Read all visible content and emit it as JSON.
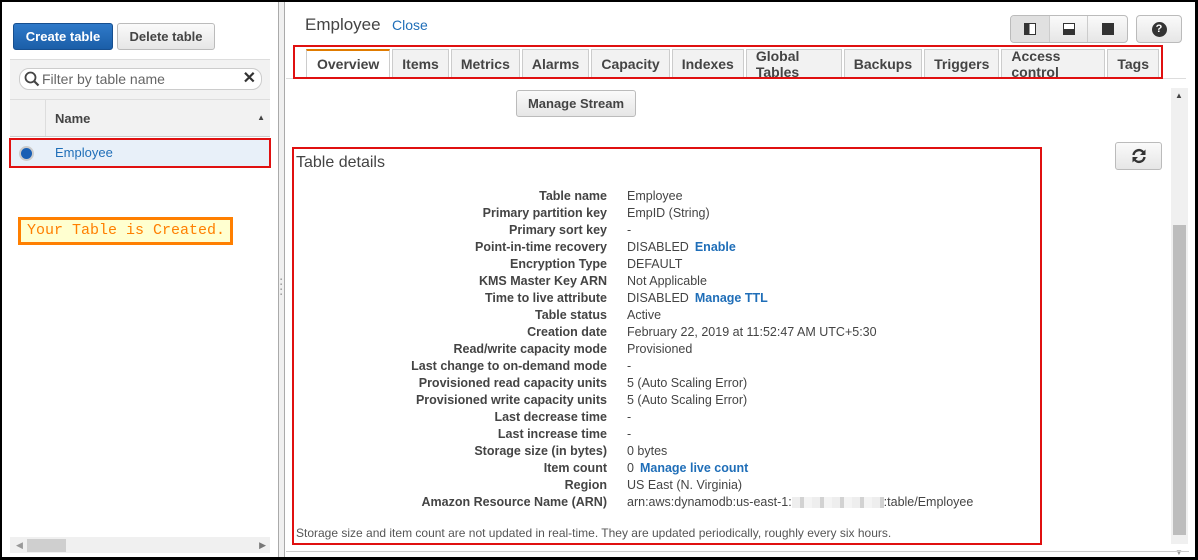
{
  "left_panel": {
    "create_button": "Create table",
    "delete_button": "Delete table",
    "filter": {
      "placeholder": "Filter by table name",
      "value": ""
    },
    "grid": {
      "columns": [
        "Name"
      ],
      "rows": [
        {
          "name": "Employee",
          "selected": true
        }
      ]
    },
    "annotation": "Your Table is Created."
  },
  "header": {
    "table_title": "Employee",
    "close_link": "Close",
    "view_modes": [
      "split-vertical-icon",
      "split-horizontal-icon",
      "full-icon"
    ],
    "help": "?"
  },
  "tabs": [
    {
      "label": "Overview",
      "active": true
    },
    {
      "label": "Items"
    },
    {
      "label": "Metrics"
    },
    {
      "label": "Alarms"
    },
    {
      "label": "Capacity"
    },
    {
      "label": "Indexes"
    },
    {
      "label": "Global Tables"
    },
    {
      "label": "Backups"
    },
    {
      "label": "Triggers"
    },
    {
      "label": "Access control"
    },
    {
      "label": "Tags"
    }
  ],
  "manage_stream_button": "Manage Stream",
  "details": {
    "title": "Table details",
    "rows": [
      {
        "key": "Table name",
        "value": "Employee"
      },
      {
        "key": "Primary partition key",
        "value": "EmpID (String)"
      },
      {
        "key": "Primary sort key",
        "value": "-"
      },
      {
        "key": "Point-in-time recovery",
        "value": "DISABLED",
        "link": "Enable"
      },
      {
        "key": "Encryption Type",
        "value": "DEFAULT"
      },
      {
        "key": "KMS Master Key ARN",
        "value": "Not Applicable"
      },
      {
        "key": "Time to live attribute",
        "value": "DISABLED",
        "link": "Manage TTL"
      },
      {
        "key": "Table status",
        "value": "Active"
      },
      {
        "key": "Creation date",
        "value": "February 22, 2019 at 11:52:47 AM UTC+5:30"
      },
      {
        "key": "Read/write capacity mode",
        "value": "Provisioned"
      },
      {
        "key": "Last change to on-demand mode",
        "value": "-"
      },
      {
        "key": "Provisioned read capacity units",
        "value": "5 (Auto Scaling Error)"
      },
      {
        "key": "Provisioned write capacity units",
        "value": "5 (Auto Scaling Error)"
      },
      {
        "key": "Last decrease time",
        "value": "-"
      },
      {
        "key": "Last increase time",
        "value": "-"
      },
      {
        "key": "Storage size (in bytes)",
        "value": "0 bytes"
      },
      {
        "key": "Item count",
        "value": "0",
        "link": "Manage live count"
      },
      {
        "key": "Region",
        "value": "US East (N. Virginia)"
      },
      {
        "key": "Amazon Resource Name (ARN)",
        "value": "arn:aws:dynamodb:us-east-1:",
        "redacted": true,
        "value_suffix": ":table/Employee"
      }
    ],
    "note": "Storage size and item count are not updated in real-time. They are updated periodically, roughly every six hours."
  },
  "colors": {
    "primary_button": "#1b5ea8",
    "link": "#1f6eb8",
    "active_tab_accent": "#e07b00",
    "highlight_border": "#e01010",
    "annotation": "#ff7f00"
  }
}
